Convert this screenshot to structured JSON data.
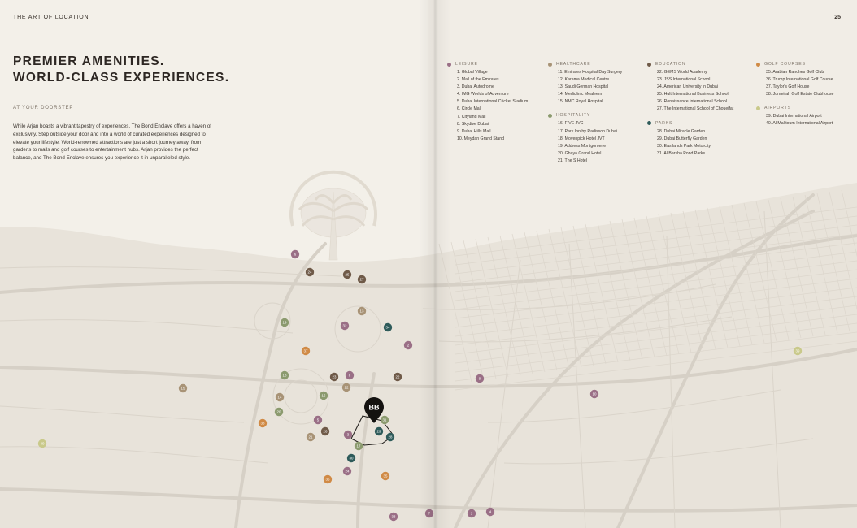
{
  "header": {
    "section_label": "THE ART OF LOCATION",
    "page_number": "25"
  },
  "headline": {
    "line1": "PREMIER AMENITIES.",
    "line2": "WORLD-CLASS EXPERIENCES."
  },
  "subhead": "AT YOUR DOORSTEP",
  "intro": "While Arjan boasts a vibrant tapestry of experiences, The Bond Enclave offers a haven of exclusivity. Step outside your door and into a world of curated experiences designed to elevate your lifestyle. World-renowned attractions are just a short journey away, from gardens to malls and golf courses to entertainment hubs. Arjan provides the perfect balance, and The Bond Enclave ensures you experience it in unparalleled style.",
  "colors": {
    "leisure": "#9a6f86",
    "healthcare": "#a89376",
    "hospitality": "#8b9a6e",
    "education": "#6f5a48",
    "parks": "#2e5b5a",
    "golf": "#d08a45",
    "airports": "#c9c98a"
  },
  "legend": {
    "leisure": {
      "title": "LEISURE",
      "items": [
        "1. Global Village",
        "2. Mall of the Emirates",
        "3. Dubai Autodrome",
        "4. IMG Worlds of Adventure",
        "5. Dubai International Cricket Stadium",
        "6. Circle Mall",
        "7. Cityland Mall",
        "8. Skydive Dubai",
        "9. Dubai Hills Mall",
        "10. Meydan Grand Stand"
      ]
    },
    "healthcare": {
      "title": "HEALTHCARE",
      "items": [
        "11. Emirates Hospital Day Surgery",
        "12. Karama Medical Centre",
        "13. Saudi German Hospital",
        "14. Mediclinic Mealeem",
        "15. NMC Royal Hospital"
      ]
    },
    "hospitality": {
      "title": "HOSPITALITY",
      "items": [
        "16. FIVE JVC",
        "17. Park Inn by Radisson Dubai",
        "18. Movenpick Hotel JVT",
        "19. Address Montgomerie",
        "20. Ghaya Grand Hotel",
        "21. The S Hotel"
      ]
    },
    "education": {
      "title": "EDUCATION",
      "items": [
        "22. GEMS World Academy",
        "23. JSS International School",
        "24. American University in Dubai",
        "25. Hult International Business School",
        "26. Renaissance International School",
        "27. The International School of Choueifat"
      ]
    },
    "parks": {
      "title": "PARKS",
      "items": [
        "28. Dubai Miracle Garden",
        "29. Dubai Butterfly Garden",
        "30. Eastlands Park Motorcity",
        "31. Al Barsha Pond Parks"
      ]
    },
    "golf": {
      "title": "GOLF COURSES",
      "items": [
        "35. Arabian Ranches Golf Club",
        "36. Trump International Golf Course",
        "37. Taylor's Golf House",
        "38. Jumeirah Golf Estate Clubhouse"
      ]
    },
    "airports": {
      "title": "AIRPORTS",
      "items": [
        "39. Dubai International Airport",
        "40. Al Maktoum International Airport"
      ]
    }
  },
  "map": {
    "logo_text": "BB",
    "markers": [
      {
        "label": "6",
        "category": "leisure"
      },
      {
        "label": "24",
        "category": "education"
      },
      {
        "label": "25",
        "category": "education"
      },
      {
        "label": "27",
        "category": "education"
      },
      {
        "label": "13",
        "category": "healthcare"
      },
      {
        "label": "19",
        "category": "hospitality"
      },
      {
        "label": "32",
        "category": "leisure"
      },
      {
        "label": "34",
        "category": "parks"
      },
      {
        "label": "37",
        "category": "golf"
      },
      {
        "label": "2",
        "category": "leisure"
      },
      {
        "label": "18",
        "category": "hospitality"
      },
      {
        "label": "23",
        "category": "education"
      },
      {
        "label": "8",
        "category": "leisure"
      },
      {
        "label": "22",
        "category": "education"
      },
      {
        "label": "12",
        "category": "healthcare"
      },
      {
        "label": "9",
        "category": "leisure"
      },
      {
        "label": "15",
        "category": "healthcare"
      },
      {
        "label": "16",
        "category": "hospitality"
      },
      {
        "label": "14",
        "category": "healthcare"
      },
      {
        "label": "20",
        "category": "hospitality"
      },
      {
        "label": "38",
        "category": "golf"
      },
      {
        "label": "5",
        "category": "leisure"
      },
      {
        "label": "26",
        "category": "education"
      },
      {
        "label": "21",
        "category": "healthcare"
      },
      {
        "label": "3",
        "category": "leisure"
      },
      {
        "label": "31",
        "category": "hospitality"
      },
      {
        "label": "29",
        "category": "parks"
      },
      {
        "label": "28",
        "category": "parks"
      },
      {
        "label": "17",
        "category": "hospitality"
      },
      {
        "label": "30",
        "category": "parks"
      },
      {
        "label": "24",
        "category": "leisure"
      },
      {
        "label": "36",
        "category": "golf"
      },
      {
        "label": "35",
        "category": "golf"
      },
      {
        "label": "33",
        "category": "leisure"
      },
      {
        "label": "7",
        "category": "leisure"
      },
      {
        "label": "1",
        "category": "leisure"
      },
      {
        "label": "4",
        "category": "leisure"
      },
      {
        "label": "10",
        "category": "leisure"
      },
      {
        "label": "39",
        "category": "airports"
      },
      {
        "label": "40",
        "category": "airports"
      }
    ]
  }
}
